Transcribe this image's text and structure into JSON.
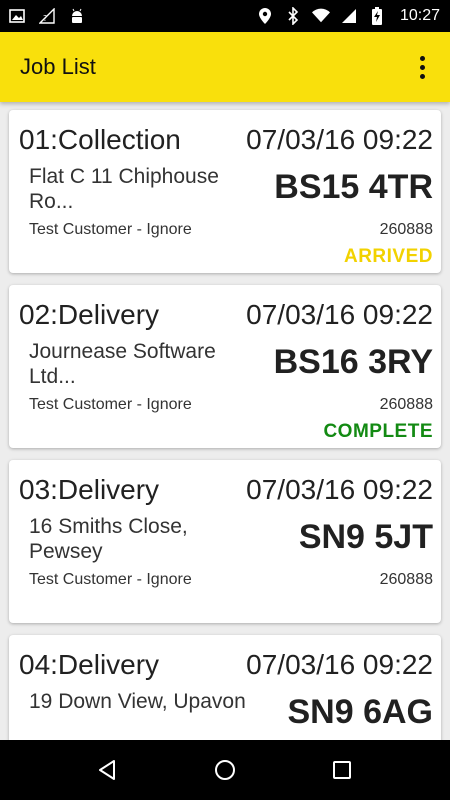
{
  "status_bar": {
    "time": "10:27",
    "left_icons": [
      "image-icon",
      "signal-off-icon",
      "android-icon"
    ],
    "right_icons": [
      "location-icon",
      "bluetooth-icon",
      "wifi-icon",
      "mobile-signal-icon",
      "battery-charging-icon"
    ]
  },
  "app_bar": {
    "title": "Job List",
    "overflow_icon": "more-vert-icon"
  },
  "colors": {
    "app_bar": "#f9e00c",
    "arrived": "#f2d200",
    "complete": "#138a13",
    "background": "#ededed"
  },
  "jobs": [
    {
      "title": "01:Collection",
      "datetime": "07/03/16 09:22",
      "address": "Flat C 11 Chiphouse Ro...",
      "postcode": "BS15 4TR",
      "customer": "Test Customer - Ignore",
      "ref": "260888",
      "status": "ARRIVED"
    },
    {
      "title": "02:Delivery",
      "datetime": "07/03/16 09:22",
      "address": "Journease Software Ltd...",
      "postcode": "BS16 3RY",
      "customer": "Test Customer - Ignore",
      "ref": "260888",
      "status": "COMPLETE"
    },
    {
      "title": "03:Delivery",
      "datetime": "07/03/16 09:22",
      "address": "16 Smiths Close, Pewsey",
      "postcode": "SN9 5JT",
      "customer": "Test Customer - Ignore",
      "ref": "260888",
      "status": ""
    },
    {
      "title": "04:Delivery",
      "datetime": "07/03/16 09:22",
      "address": "19 Down View, Upavon",
      "postcode": "SN9 6AG",
      "customer": "",
      "ref": "",
      "status": ""
    }
  ],
  "nav_bar": {
    "back_icon": "back-icon",
    "home_icon": "home-icon",
    "recents_icon": "recents-icon"
  }
}
